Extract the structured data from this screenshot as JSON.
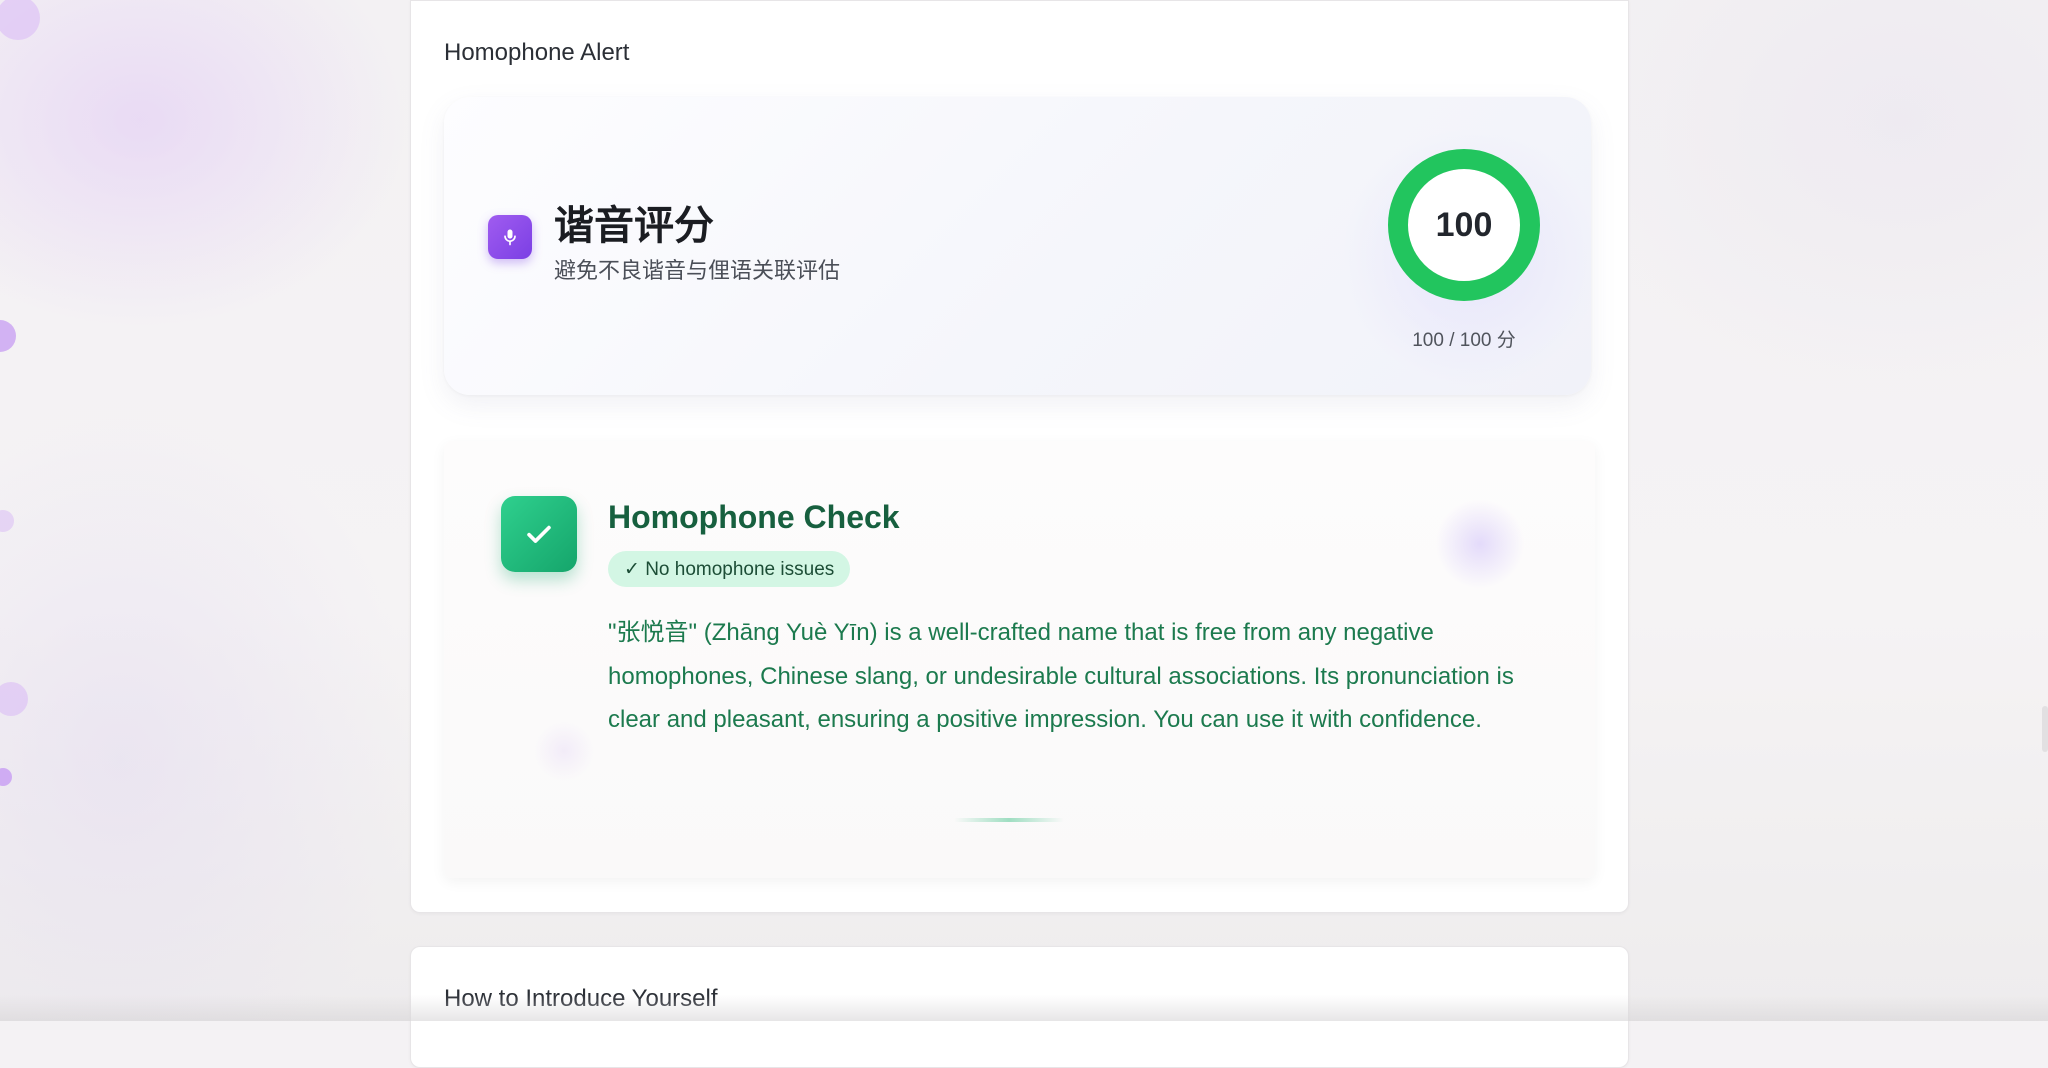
{
  "homophone_panel": {
    "title": "Homophone Alert",
    "score_card": {
      "icon": "microphone-icon",
      "title": "谐音评分",
      "subtitle": "避免不良谐音与俚语关联评估",
      "score_value": "100",
      "score_fraction": 1.0,
      "score_caption": "100 / 100 分",
      "ring_color": "#22c55e"
    },
    "check_card": {
      "icon": "checkmark-icon",
      "title": "Homophone Check",
      "status_label": "✓ No homophone issues",
      "description": "\"张悦音\" (Zhāng Yuè Yīn) is a well-crafted name that is free from any negative homophones, Chinese slang, or undesirable cultural associations. Its pronunciation is clear and pleasant, ensuring a positive impression. You can use it with confidence.",
      "accent_color": "#1c7a4e"
    }
  },
  "introduce_panel": {
    "title": "How to Introduce Yourself"
  }
}
